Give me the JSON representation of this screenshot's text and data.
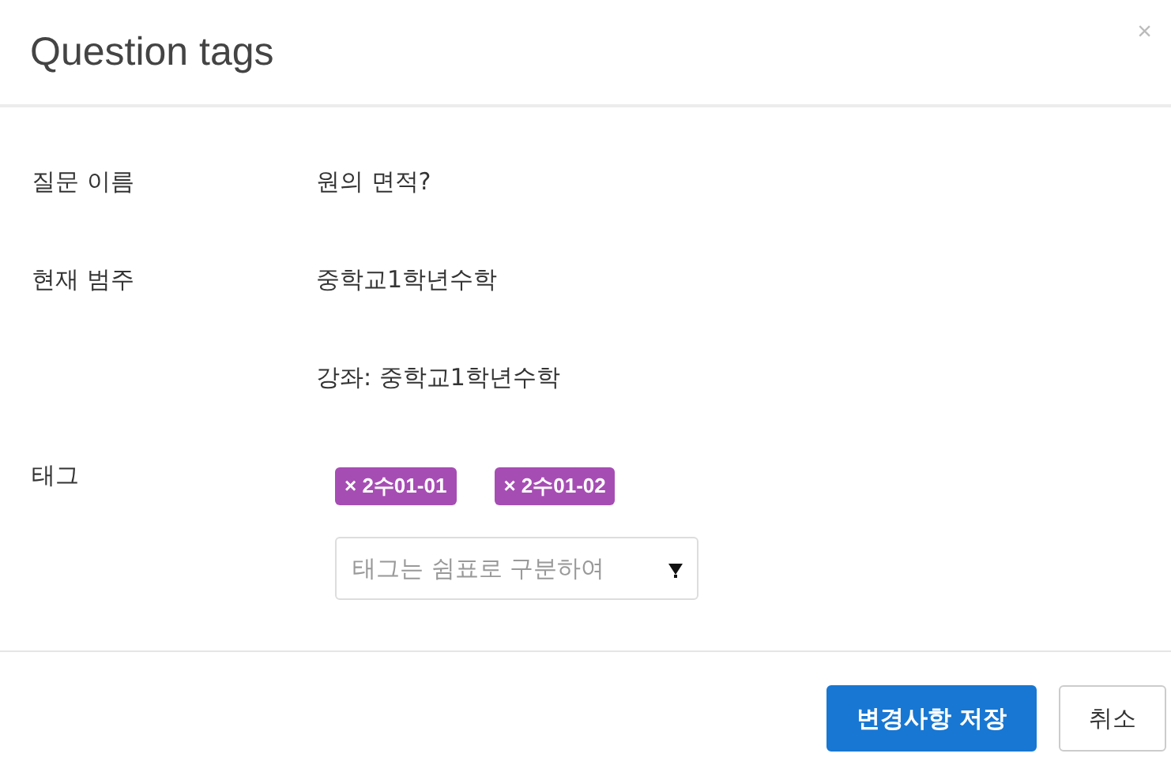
{
  "dialog": {
    "title": "Question tags",
    "close": "×"
  },
  "fields": [
    {
      "label": "질문 이름",
      "value": "원의 면적?"
    },
    {
      "label": "현재 범주",
      "value": "중학교1학년수학"
    },
    {
      "value": "강좌: 중학교1학년수학"
    }
  ],
  "tags": {
    "label": "태그",
    "items": [
      {
        "text": "× 2수01-01",
        "color": "#a64db4"
      },
      {
        "text": "× 2수01-02",
        "color": "#a64db4"
      }
    ],
    "input": {
      "placeholder": "태그는 쉼표로 구분하여"
    }
  },
  "buttons": [
    {
      "label": "변경사항 저장",
      "kind": "primary"
    },
    {
      "label": "취소",
      "kind": "default"
    }
  ]
}
